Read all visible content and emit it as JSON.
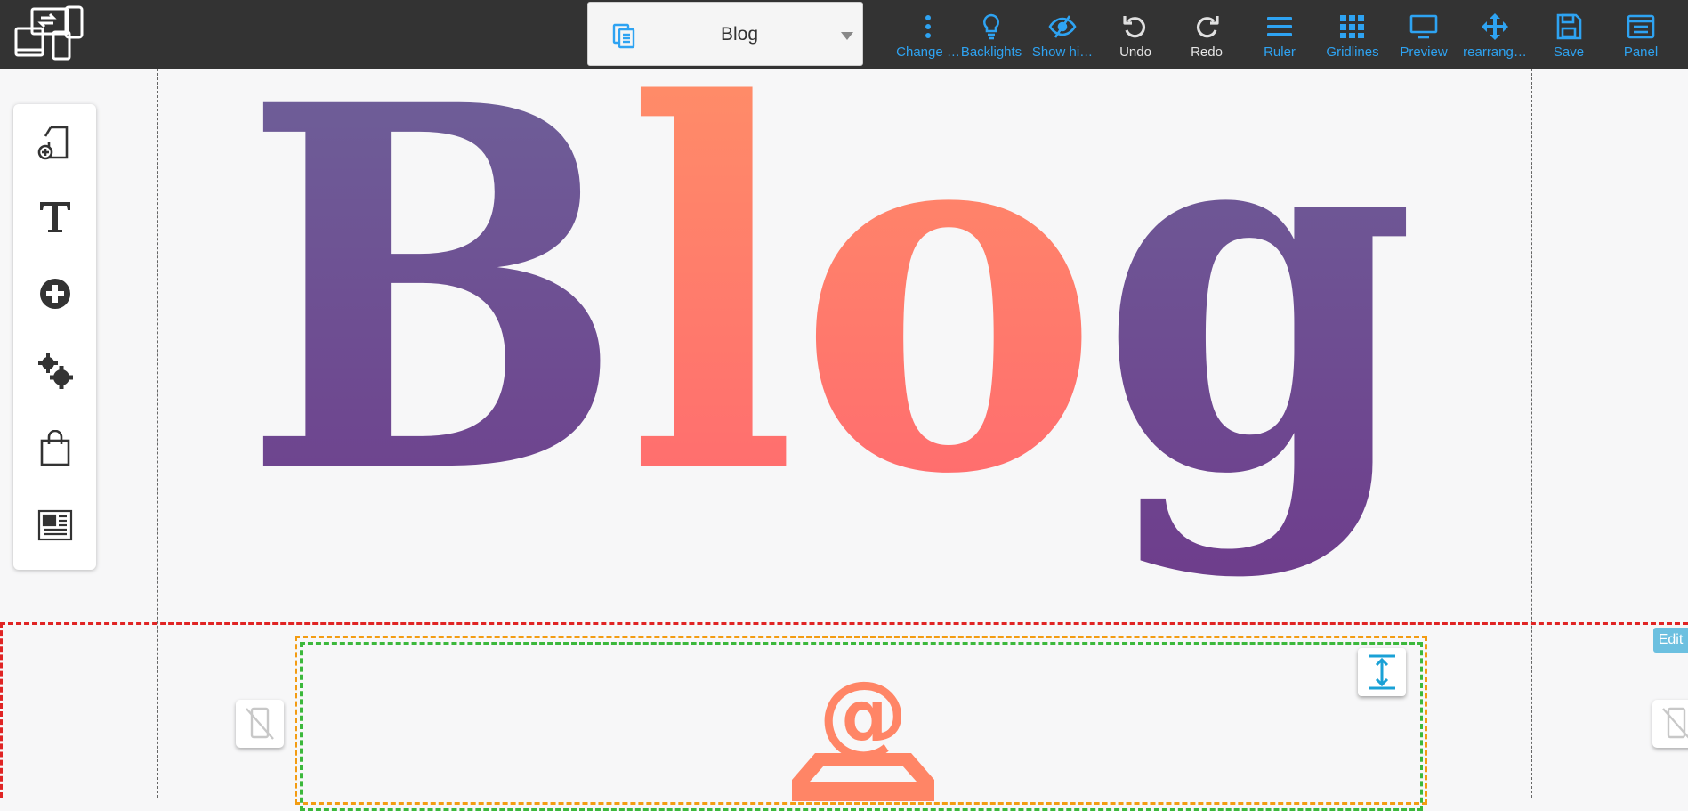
{
  "toolbar": {
    "page_selector": {
      "selected": "Blog"
    },
    "tools": [
      {
        "id": "change",
        "label": "Change …",
        "icon": "dots-vertical-icon",
        "color": "#2ea3f2"
      },
      {
        "id": "backlights",
        "label": "Backlights",
        "icon": "lightbulb-icon",
        "color": "#2ea3f2"
      },
      {
        "id": "show-hidden",
        "label": "Show hi…",
        "icon": "eye-slash-icon",
        "color": "#2ea3f2"
      },
      {
        "id": "undo",
        "label": "Undo",
        "icon": "undo-icon",
        "color": "#e6e6e6"
      },
      {
        "id": "redo",
        "label": "Redo",
        "icon": "redo-icon",
        "color": "#e6e6e6"
      },
      {
        "id": "ruler",
        "label": "Ruler",
        "icon": "ruler-icon",
        "color": "#2ea3f2"
      },
      {
        "id": "gridlines",
        "label": "Gridlines",
        "icon": "grid-icon",
        "color": "#2ea3f2"
      },
      {
        "id": "preview",
        "label": "Preview",
        "icon": "monitor-icon",
        "color": "#2ea3f2"
      },
      {
        "id": "rearrange",
        "label": "rearrang…",
        "icon": "move-arrows-icon",
        "color": "#2ea3f2"
      },
      {
        "id": "save",
        "label": "Save",
        "icon": "floppy-icon",
        "color": "#2ea3f2"
      },
      {
        "id": "panel",
        "label": "Panel",
        "icon": "panel-icon",
        "color": "#2ea3f2"
      }
    ]
  },
  "palette": {
    "items": [
      "add-page-icon",
      "text-icon",
      "add-element-icon",
      "settings-gears-icon",
      "shopping-bag-icon",
      "newspaper-icon"
    ]
  },
  "hero": {
    "title": "Blog",
    "gradient_purple": [
      "#6e649a",
      "#6e3d8c"
    ],
    "gradient_coral": [
      "#ff9267",
      "#ff6670"
    ]
  },
  "section": {
    "edit_label": "Edit",
    "accent": "#ff8566"
  }
}
